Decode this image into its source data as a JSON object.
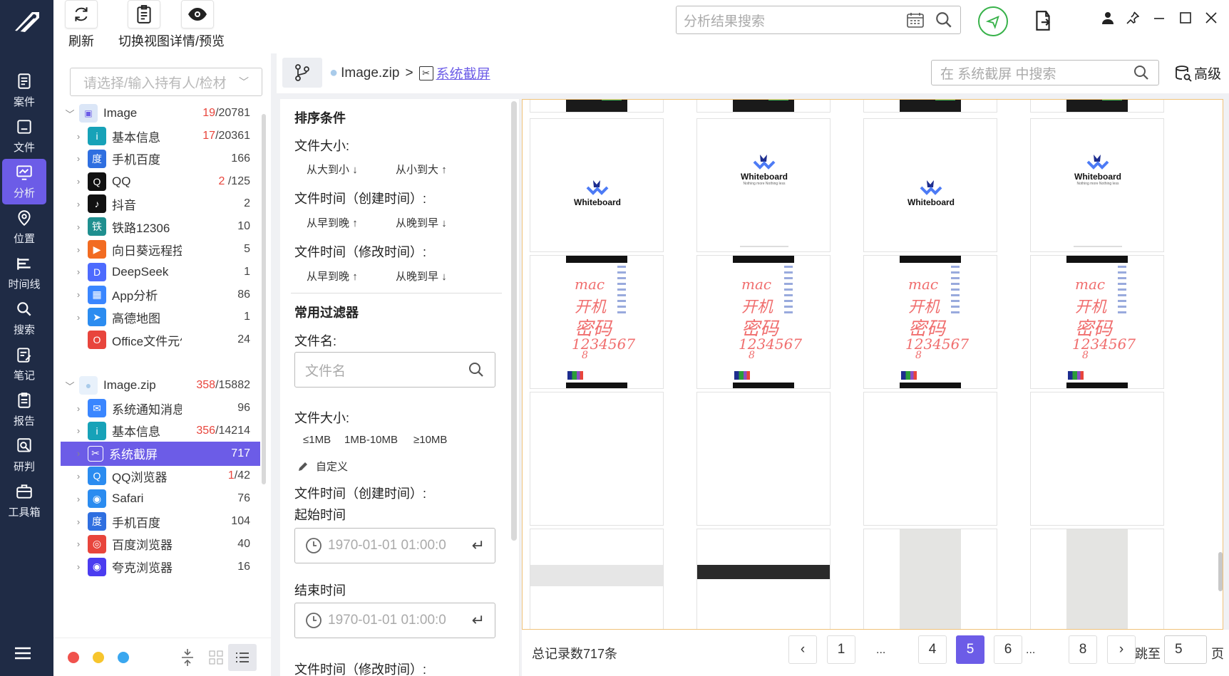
{
  "toolbar": {
    "refresh": "刷新",
    "switch_view": "切换视图",
    "detail_preview": "详情/预览"
  },
  "top_search": {
    "placeholder": "分析结果搜索"
  },
  "nav": {
    "items": [
      "案件",
      "文件",
      "分析",
      "位置",
      "时间线",
      "搜索",
      "笔记",
      "报告",
      "研判",
      "工具箱"
    ],
    "active": "分析"
  },
  "owner_select": {
    "placeholder": "请选择/输入持有人/检材"
  },
  "tree": {
    "group1": {
      "name": "Image",
      "count_red": "19",
      "count_total": "/20781"
    },
    "group1_items": [
      {
        "label": "基本信息",
        "count_red": "17",
        "count_total": "/20361",
        "color": "#17a2b8",
        "glyph": "i"
      },
      {
        "label": "手机百度",
        "count_red": "",
        "count_total": "166",
        "color": "#2f6fe0",
        "glyph": "度"
      },
      {
        "label": "QQ",
        "count_red": "2",
        "count_total": " /125",
        "color": "#111111",
        "glyph": "Q"
      },
      {
        "label": "抖音",
        "count_red": "",
        "count_total": "2",
        "color": "#111111",
        "glyph": "♪"
      },
      {
        "label": "铁路12306",
        "count_red": "",
        "count_total": "10",
        "color": "#1f8f8f",
        "glyph": "铁"
      },
      {
        "label": "向日葵远程控制",
        "count_red": "",
        "count_total": "5",
        "color": "#f26b21",
        "glyph": "▶"
      },
      {
        "label": "DeepSeek",
        "count_red": "",
        "count_total": "1",
        "color": "#4d6bfe",
        "glyph": "D"
      },
      {
        "label": "App分析",
        "count_red": "",
        "count_total": "86",
        "color": "#3a86ff",
        "glyph": "▦"
      },
      {
        "label": "高德地图",
        "count_red": "",
        "count_total": "1",
        "color": "#2b8cf0",
        "glyph": "➤"
      },
      {
        "label": "Office文件元信息",
        "count_red": "",
        "count_total": "24",
        "color": "#e8453c",
        "glyph": "O"
      }
    ],
    "group2": {
      "name": "Image.zip",
      "count_red": "358",
      "count_total": "/15882"
    },
    "group2_items": [
      {
        "label": "系统通知消息",
        "count_red": "",
        "count_total": "96",
        "color": "#3a86ff",
        "glyph": "✉"
      },
      {
        "label": "基本信息",
        "count_red": "356",
        "count_total": "/14214",
        "color": "#17a2b8",
        "glyph": "i"
      },
      {
        "label": "系统截屏",
        "count_red": "",
        "count_total": "717",
        "color": "#6c5ce7",
        "glyph": "✂"
      },
      {
        "label": "QQ浏览器",
        "count_red": "1",
        "count_total": "/42",
        "color": "#2b8cf0",
        "glyph": "Q"
      },
      {
        "label": "Safari",
        "count_red": "",
        "count_total": "76",
        "color": "#2b8cf0",
        "glyph": "◉"
      },
      {
        "label": "手机百度",
        "count_red": "",
        "count_total": "104",
        "color": "#2f6fe0",
        "glyph": "度"
      },
      {
        "label": "百度浏览器",
        "count_red": "",
        "count_total": "40",
        "color": "#e8453c",
        "glyph": "◎"
      },
      {
        "label": "夸克浏览器",
        "count_red": "",
        "count_total": "16",
        "color": "#4b3cf0",
        "glyph": "◉"
      }
    ]
  },
  "breadcrumb": {
    "root": "Image.zip",
    "sep": ">",
    "current": "系统截屏"
  },
  "scoped_search": {
    "placeholder": "在 系统截屏 中搜索",
    "advanced": "高级"
  },
  "filters": {
    "sort_title": "排序条件",
    "size_label": "文件大小:",
    "size_desc": "从大到小",
    "size_asc": "从小到大",
    "ctime_label": "文件时间（创建时间）:",
    "mtime_label": "文件时间（修改时间）:",
    "early_late": "从早到晚",
    "late_early": "从晚到早",
    "common_title": "常用过滤器",
    "filename_label": "文件名:",
    "filename_placeholder": "文件名",
    "size2_label": "文件大小:",
    "size_opts": [
      "≤1MB",
      "1MB-10MB",
      "≥10MB"
    ],
    "custom": "自定义",
    "ctime2_label": "文件时间（创建时间）:",
    "start_label": "起始时间",
    "start_value": "1970-01-01 01:00:0",
    "end_label": "结束时间",
    "end_value": "1970-01-01 01:00:0",
    "mtime2_label": "文件时间（修改时间）:"
  },
  "gallery": {
    "brand": "Whiteboard",
    "tagline": "Nothing more Nothing less",
    "handwriting": [
      "mac",
      "开机",
      "密码",
      "1234567",
      "8"
    ]
  },
  "footer": {
    "total": "总记录数717条",
    "pages": [
      "1",
      "4",
      "5",
      "6",
      "8"
    ],
    "current_page": "5",
    "ellipsis": "...",
    "goto_label": "跳至",
    "goto_value": "5",
    "page_suffix": "页"
  },
  "colors": {
    "nav_bg": "#1f2b45",
    "accent": "#6c5ce7",
    "green": "#38b24a",
    "count_red": "#e8453c"
  }
}
